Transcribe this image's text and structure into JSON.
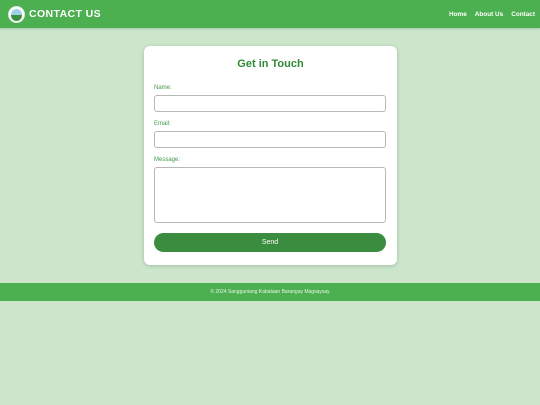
{
  "header": {
    "title": "CONTACT US",
    "logo_icon": "barangay-seal-icon",
    "nav": [
      "Home",
      "About Us",
      "Contact"
    ]
  },
  "form": {
    "heading": "Get in Touch",
    "name_label": "Name:",
    "name_value": "",
    "email_label": "Email:",
    "email_value": "",
    "message_label": "Message:",
    "message_value": "",
    "send_label": "Send"
  },
  "footer": {
    "text": "© 2024 Sangguniang Kabataan Barangay Magsaysay"
  },
  "colors": {
    "brand": "#4caf50",
    "page_background": "#cbe6cb",
    "button": "#3a8c3e",
    "heading": "#2f8a35"
  }
}
